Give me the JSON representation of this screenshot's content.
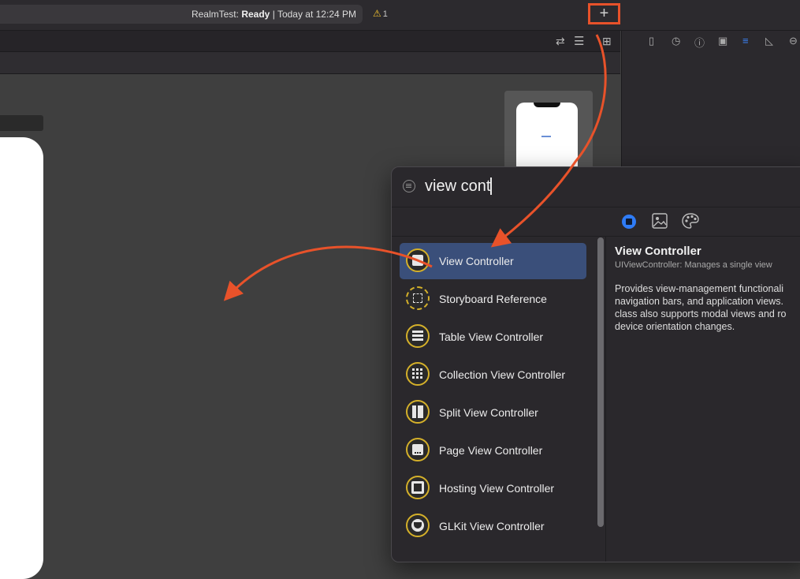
{
  "toolbar": {
    "status_project": "RealmTest:",
    "status_state": "Ready",
    "status_time": "| Today at 12:24 PM",
    "warning_count": "1",
    "add_button_label": "+"
  },
  "editor_icons": [
    "swap-icon",
    "lines-icon",
    "add-editor-icon"
  ],
  "inspector_icons": [
    "file-icon",
    "history-icon",
    "help-icon",
    "identity-icon",
    "attributes-icon",
    "size-icon",
    "connections-icon"
  ],
  "library": {
    "search_value": "view cont",
    "segments": [
      "objects-icon",
      "media-icon",
      "colors-icon"
    ],
    "items": [
      {
        "label": "View Controller",
        "icon": "view-controller-icon",
        "selected": true
      },
      {
        "label": "Storyboard Reference",
        "icon": "storyboard-reference-icon",
        "selected": false
      },
      {
        "label": "Table View Controller",
        "icon": "table-view-controller-icon",
        "selected": false
      },
      {
        "label": "Collection View Controller",
        "icon": "collection-view-controller-icon",
        "selected": false
      },
      {
        "label": "Split View Controller",
        "icon": "split-view-controller-icon",
        "selected": false
      },
      {
        "label": "Page View Controller",
        "icon": "page-view-controller-icon",
        "selected": false
      },
      {
        "label": "Hosting View Controller",
        "icon": "hosting-view-controller-icon",
        "selected": false
      },
      {
        "label": "GLKit View Controller",
        "icon": "glkit-view-controller-icon",
        "selected": false
      }
    ],
    "detail": {
      "title": "View Controller",
      "subtitle": "UIViewController: Manages a single view",
      "description": "Provides view-management functionali\nnavigation bars, and application views. \nclass also supports modal views and ro\ndevice orientation changes."
    }
  },
  "colors": {
    "annotation": "#e8522a",
    "selection": "#3a4f7a",
    "icon_ring": "#d4b02a",
    "accent": "#2f7cf6"
  }
}
